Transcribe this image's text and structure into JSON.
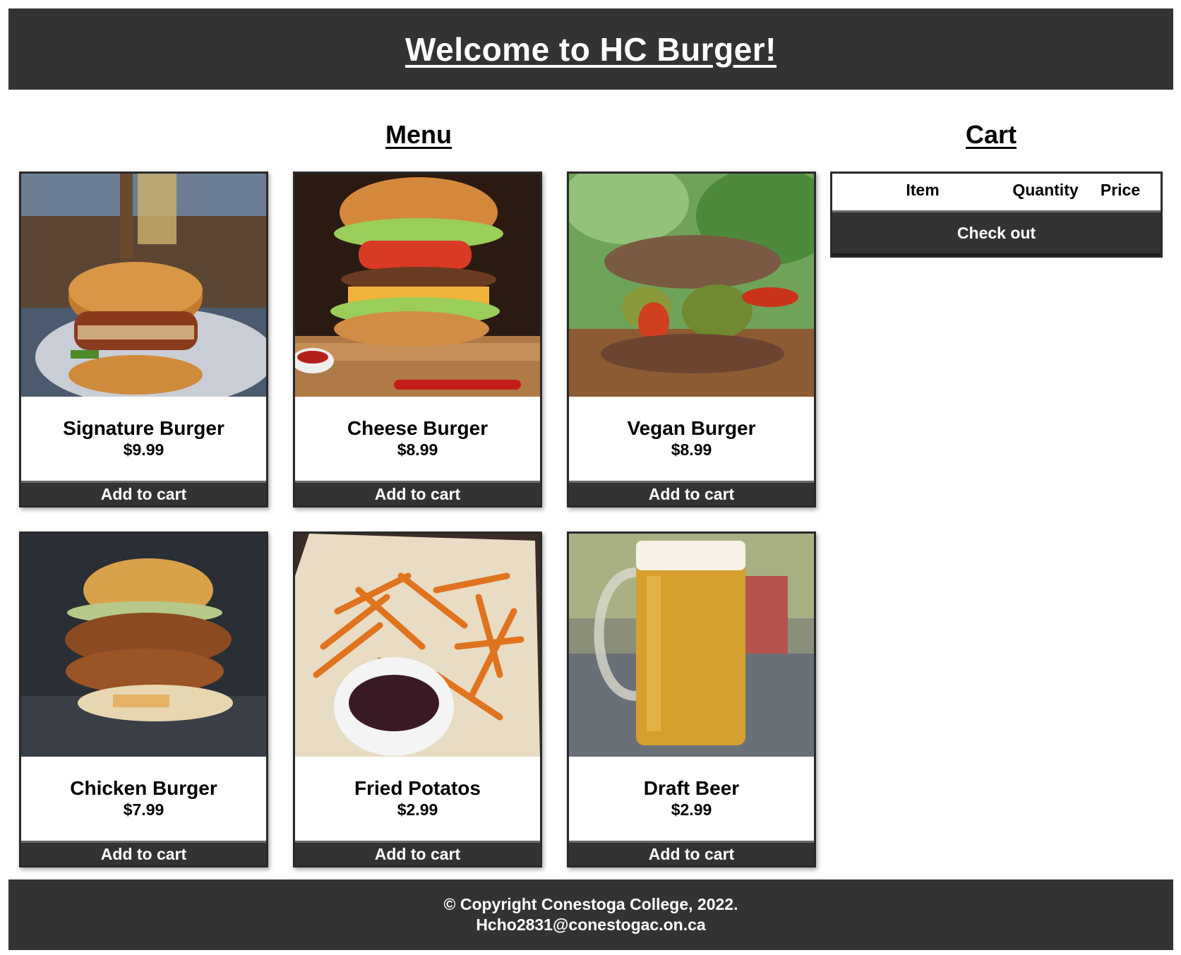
{
  "header": {
    "title": "Welcome to HC Burger!"
  },
  "menu": {
    "title": "Menu",
    "items": [
      {
        "name": "Signature Burger",
        "price": "$9.99",
        "button": "Add to cart",
        "image": "signature-burger-photo"
      },
      {
        "name": "Cheese Burger",
        "price": "$8.99",
        "button": "Add to cart",
        "image": "cheese-burger-photo"
      },
      {
        "name": "Vegan Burger",
        "price": "$8.99",
        "button": "Add to cart",
        "image": "vegan-burger-photo"
      },
      {
        "name": "Chicken Burger",
        "price": "$7.99",
        "button": "Add to cart",
        "image": "chicken-burger-photo"
      },
      {
        "name": "Fried Potatos",
        "price": "$2.99",
        "button": "Add to cart",
        "image": "fried-potatoes-photo"
      },
      {
        "name": "Draft Beer",
        "price": "$2.99",
        "button": "Add to cart",
        "image": "draft-beer-photo"
      }
    ]
  },
  "cart": {
    "title": "Cart",
    "columns": {
      "item": "Item",
      "quantity": "Quantity",
      "price": "Price"
    },
    "checkout_label": "Check out"
  },
  "footer": {
    "copyright": "© Copyright Conestoga College, 2022.",
    "email": "Hcho2831@conestogac.on.ca"
  },
  "colors": {
    "bar": "#333333",
    "background": "#ffffff",
    "text": "#000000"
  }
}
